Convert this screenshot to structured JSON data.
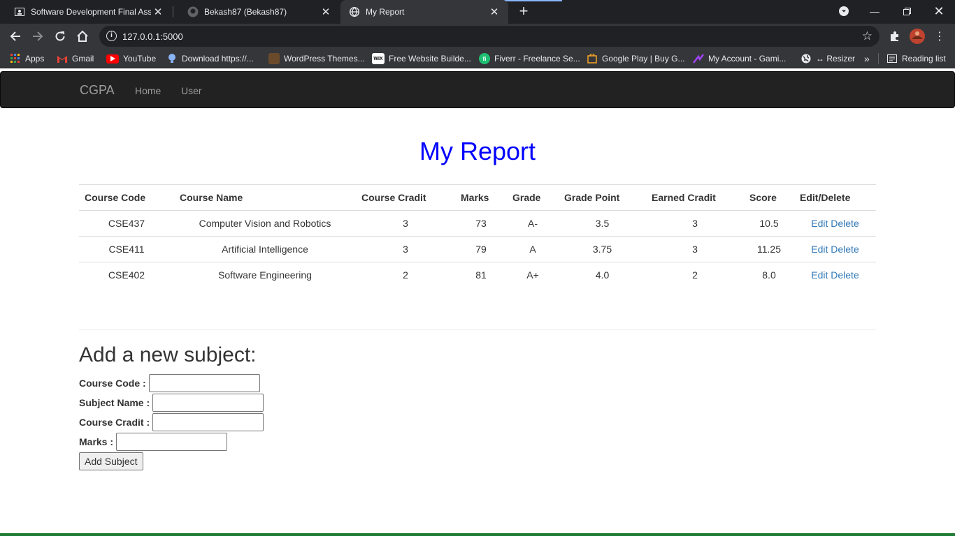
{
  "browser": {
    "tabs": [
      {
        "title": "Software Development Final Assi",
        "icon": "classroom-icon",
        "active": false
      },
      {
        "title": "Bekash87 (Bekash87)",
        "icon": "github-icon",
        "active": false
      },
      {
        "title": "My Report",
        "icon": "globe-icon",
        "active": true
      }
    ],
    "url": "127.0.0.1:5000",
    "bookmarks": [
      {
        "label": "Apps",
        "icon": "apps-grid-icon"
      },
      {
        "label": "Gmail",
        "icon": "gmail-icon"
      },
      {
        "label": "YouTube",
        "icon": "youtube-icon"
      },
      {
        "label": "Download https://...",
        "icon": "bulb-icon"
      },
      {
        "label": "WordPress Themes...",
        "icon": "wordpress-themes-icon"
      },
      {
        "label": "Free Website Builde...",
        "icon": "wix-icon"
      },
      {
        "label": "Fiverr - Freelance Se...",
        "icon": "fiverr-icon"
      },
      {
        "label": "Google Play | Buy G...",
        "icon": "google-play-icon"
      },
      {
        "label": "My Account - Gami...",
        "icon": "gamiphy-icon"
      },
      {
        "label": "↔ Resizer",
        "icon": "globe-icon"
      }
    ],
    "reading_list": "Reading list",
    "more_bookmarks": "»"
  },
  "navbar": {
    "brand": "CGPA",
    "links": [
      "Home",
      "User"
    ]
  },
  "report": {
    "title": "My Report",
    "headers": [
      "Course Code",
      "Course Name",
      "Course Cradit",
      "Marks",
      "Grade",
      "Grade Point",
      "Earned Cradit",
      "Score",
      "Edit/Delete"
    ],
    "rows": [
      {
        "code": "CSE437",
        "name": "Computer Vision and Robotics",
        "credit": "3",
        "marks": "73",
        "grade": "A-",
        "grade_point": "3.5",
        "earned": "3",
        "score": "10.5",
        "edit": "Edit",
        "delete": "Delete"
      },
      {
        "code": "CSE411",
        "name": "Artificial Intelligence",
        "credit": "3",
        "marks": "79",
        "grade": "A",
        "grade_point": "3.75",
        "earned": "3",
        "score": "11.25",
        "edit": "Edit",
        "delete": "Delete"
      },
      {
        "code": "CSE402",
        "name": "Software Engineering",
        "credit": "2",
        "marks": "81",
        "grade": "A+",
        "grade_point": "4.0",
        "earned": "2",
        "score": "8.0",
        "edit": "Edit",
        "delete": "Delete"
      }
    ]
  },
  "form": {
    "title": "Add a new subject:",
    "fields": [
      {
        "label": "Course Code :",
        "value": ""
      },
      {
        "label": "Subject Name :",
        "value": ""
      },
      {
        "label": "Course Cradit :",
        "value": ""
      },
      {
        "label": "Marks :",
        "value": ""
      }
    ],
    "submit": "Add Subject"
  }
}
